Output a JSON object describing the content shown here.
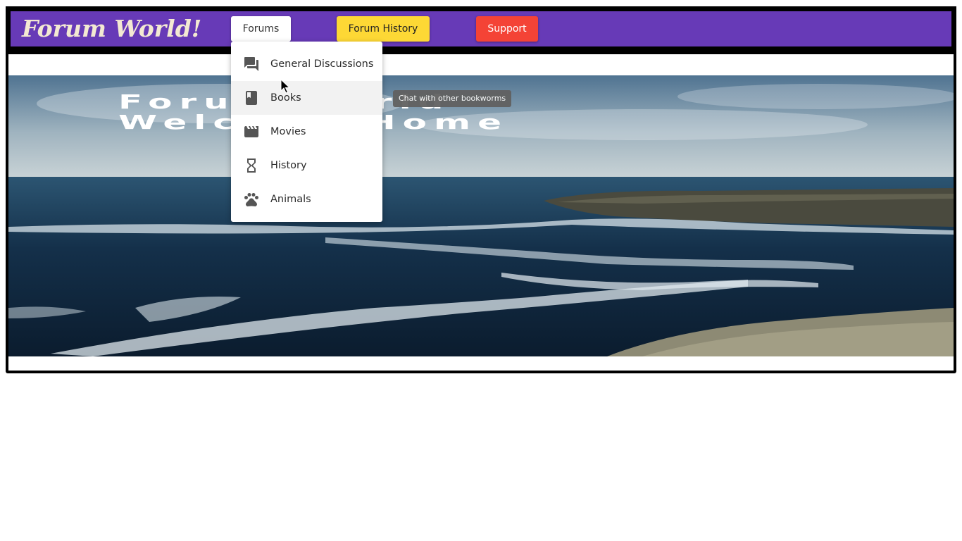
{
  "header": {
    "site_title": "Forum World!",
    "nav": {
      "forums_label": "Forums",
      "forum_history_label": "Forum History",
      "support_label": "Support"
    },
    "colors": {
      "header_bg": "#673ab7",
      "forums_button": "#ffffff",
      "forum_history_button": "#fdd835",
      "support_button": "#f44336"
    }
  },
  "hero": {
    "line1": "Forum World",
    "line2": "Welcome Home",
    "image": "sea-coast-cliffs"
  },
  "dropdown": {
    "items": [
      {
        "label": "General Discussions",
        "icon": "forum-icon"
      },
      {
        "label": "Books",
        "icon": "book-icon"
      },
      {
        "label": "Movies",
        "icon": "movie-icon"
      },
      {
        "label": "History",
        "icon": "hourglass-icon"
      },
      {
        "label": "Animals",
        "icon": "paw-icon"
      }
    ],
    "hovered_item": "Books"
  },
  "tooltip": {
    "text": "Chat with other bookworms"
  }
}
